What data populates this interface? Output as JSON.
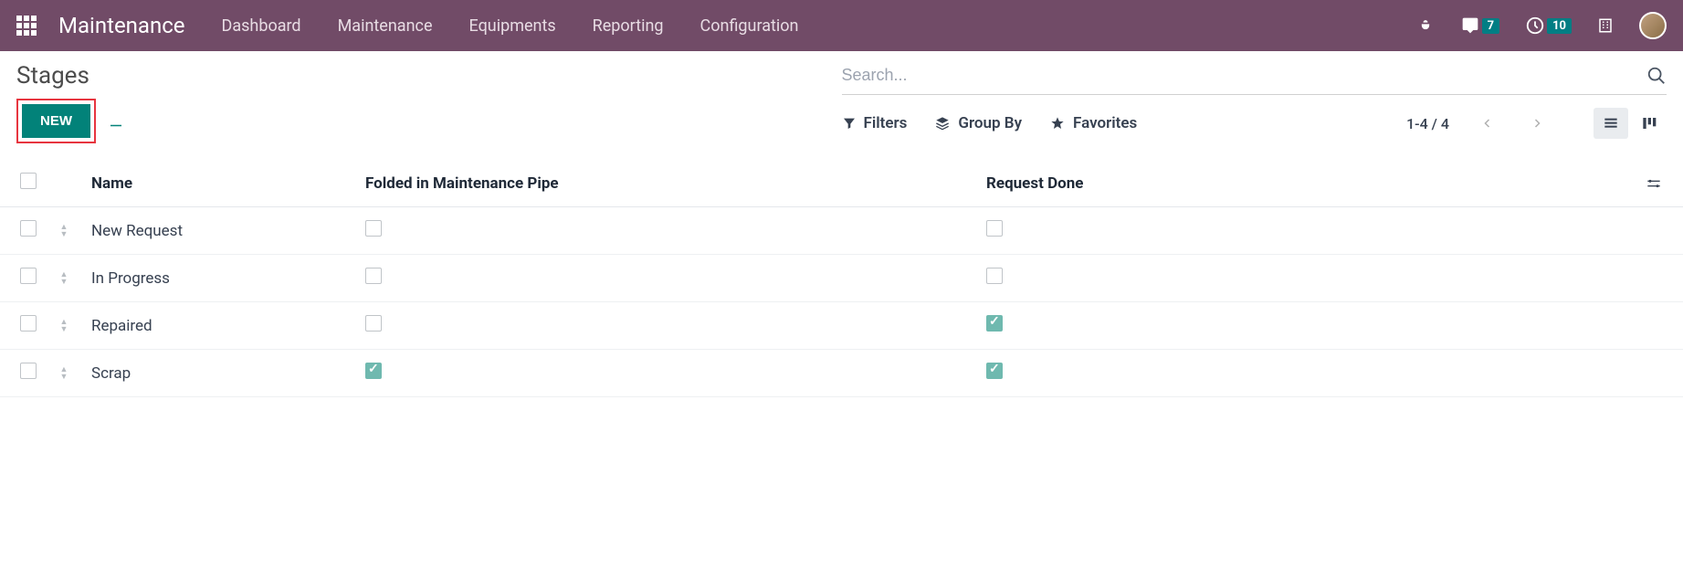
{
  "topbar": {
    "app_title": "Maintenance",
    "nav": [
      "Dashboard",
      "Maintenance",
      "Equipments",
      "Reporting",
      "Configuration"
    ],
    "messages_badge": "7",
    "activities_badge": "10"
  },
  "control": {
    "breadcrumb": "Stages",
    "new_label": "NEW",
    "search_placeholder": "Search...",
    "filters_label": "Filters",
    "groupby_label": "Group By",
    "favorites_label": "Favorites",
    "pager": "1-4 / 4"
  },
  "table": {
    "headers": {
      "name": "Name",
      "folded": "Folded in Maintenance Pipe",
      "done": "Request Done"
    },
    "rows": [
      {
        "name": "New Request",
        "folded": false,
        "done": false
      },
      {
        "name": "In Progress",
        "folded": false,
        "done": false
      },
      {
        "name": "Repaired",
        "folded": false,
        "done": true
      },
      {
        "name": "Scrap",
        "folded": true,
        "done": true
      }
    ]
  }
}
